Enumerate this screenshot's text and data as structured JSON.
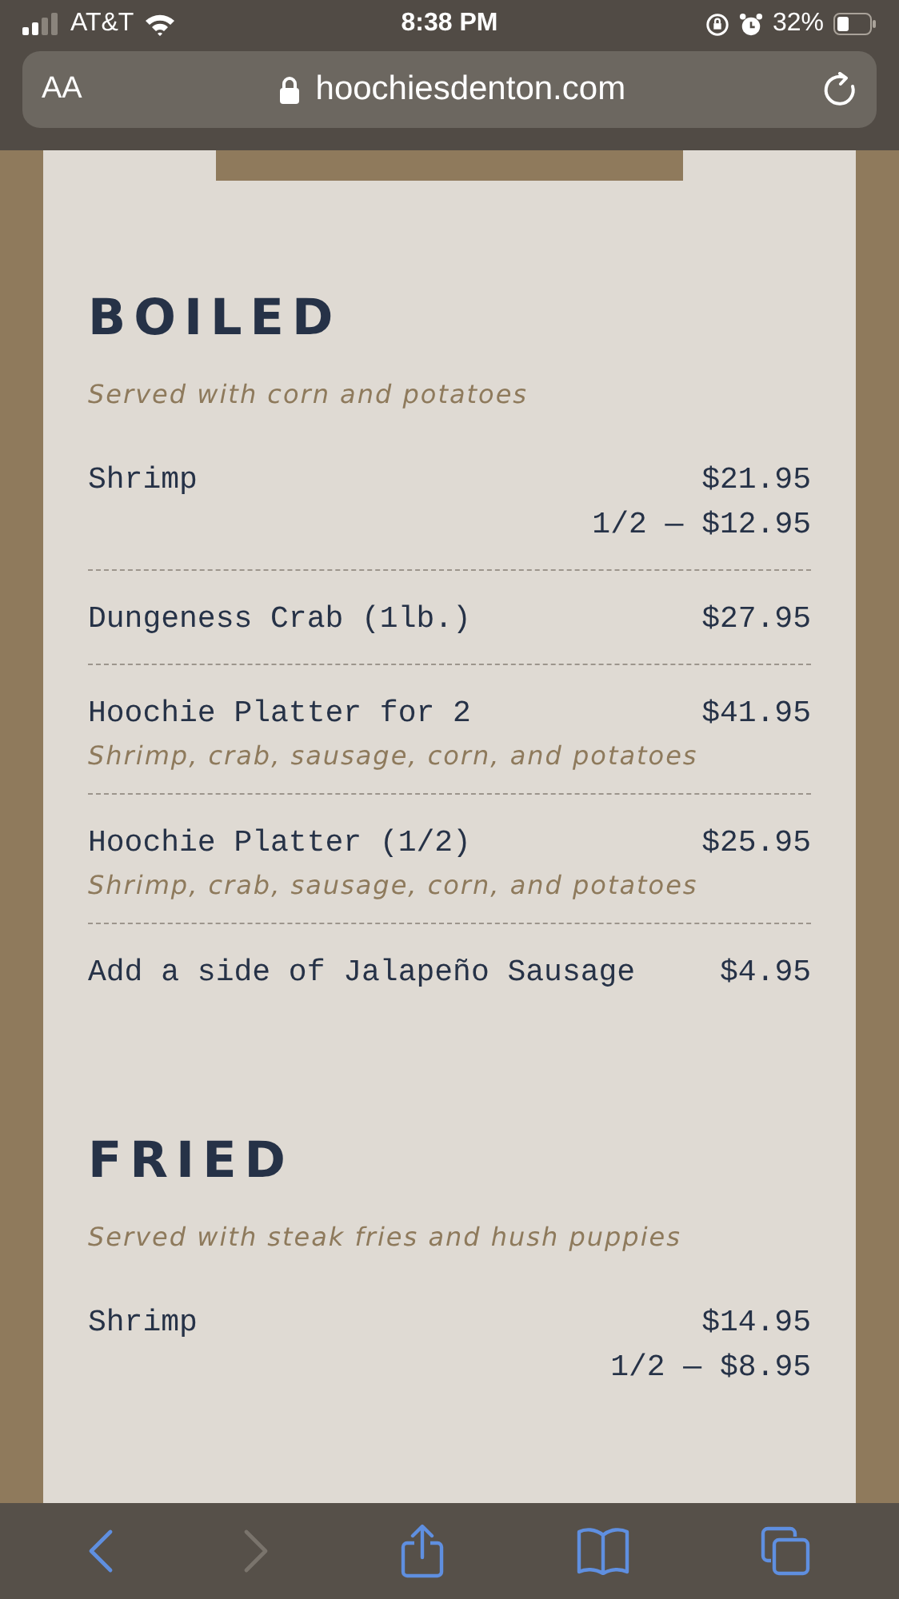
{
  "status_bar": {
    "carrier": "AT&T",
    "time": "8:38 PM",
    "battery": "32%"
  },
  "address_bar": {
    "text_size_button": "AA",
    "url": "hoochiesdenton.com"
  },
  "sections": [
    {
      "heading": "BOILED",
      "subtitle": "Served with corn and potatoes",
      "items": [
        {
          "name": "Shrimp",
          "price": "$21.95",
          "half_price": "1/2 — $12.95"
        },
        {
          "name": "Dungeness Crab (1lb.)",
          "price": "$27.95"
        },
        {
          "name": "Hoochie Platter for 2",
          "price": "$41.95",
          "description": "Shrimp, crab, sausage, corn, and potatoes"
        },
        {
          "name": "Hoochie Platter (1/2)",
          "price": "$25.95",
          "description": "Shrimp, crab, sausage, corn, and potatoes"
        },
        {
          "name": "Add a side of Jalapeño Sausage",
          "price": "$4.95"
        }
      ]
    },
    {
      "heading": "FRIED",
      "subtitle": "Served with steak fries and hush puppies",
      "items": [
        {
          "name": "Shrimp",
          "price": "$14.95",
          "half_price": "1/2 — $8.95"
        }
      ]
    }
  ],
  "toolbar": {
    "back": {
      "disabled": false
    },
    "forward": {
      "disabled": true
    }
  }
}
